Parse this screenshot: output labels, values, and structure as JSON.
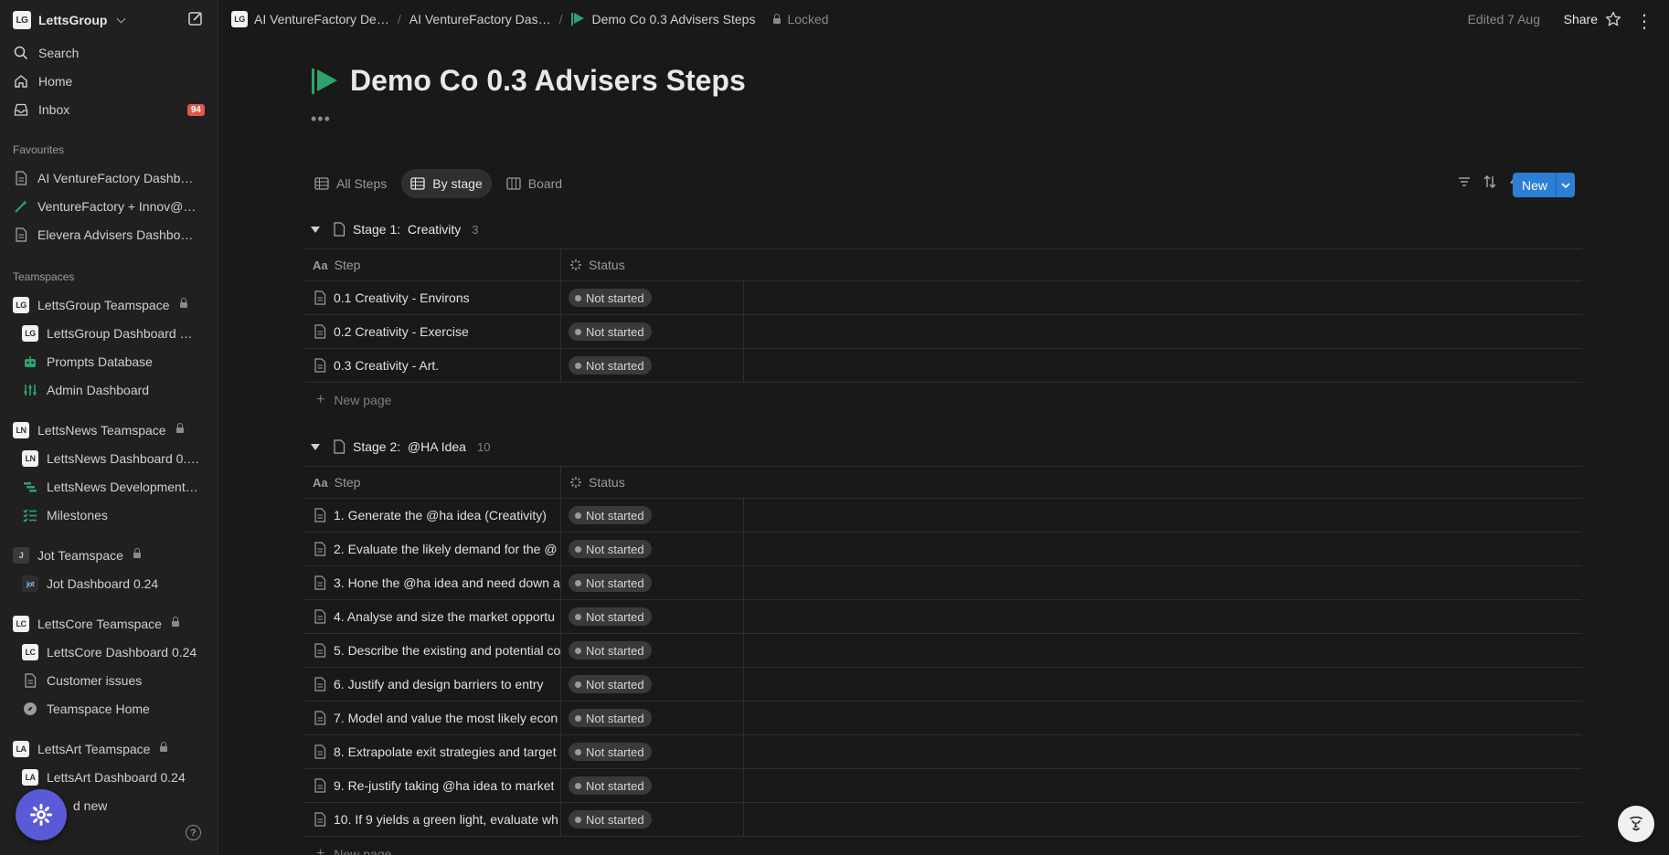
{
  "sidebar": {
    "workspace": {
      "logo": "LG",
      "name": "LettsGroup"
    },
    "nav": [
      {
        "label": "Search",
        "icon": "search-icon"
      },
      {
        "label": "Home",
        "icon": "home-icon"
      },
      {
        "label": "Inbox",
        "icon": "inbox-icon",
        "badge": "94"
      }
    ],
    "favourites_label": "Favourites",
    "favourites": [
      {
        "label": "AI VentureFactory Dashb…",
        "icon": "page-icon"
      },
      {
        "label": "VentureFactory + Innov@…",
        "icon": "magic-wand-icon"
      },
      {
        "label": "Elevera Advisers Dashbo…",
        "icon": "page-icon"
      }
    ],
    "teamspaces_label": "Teamspaces",
    "teamspaces": [
      {
        "logo": "LG",
        "name": "LettsGroup Teamspace",
        "items": [
          {
            "label": "LettsGroup Dashboard …",
            "icon": "LG"
          },
          {
            "label": "Prompts Database",
            "icon": "robot-icon"
          },
          {
            "label": "Admin Dashboard",
            "icon": "sliders-icon"
          }
        ]
      },
      {
        "logo": "LN",
        "name": "LettsNews Teamspace",
        "items": [
          {
            "label": "LettsNews Dashboard 0.…",
            "icon": "LN"
          },
          {
            "label": "LettsNews Development…",
            "icon": "gantt-icon"
          },
          {
            "label": "Milestones",
            "icon": "checklist-icon"
          }
        ]
      },
      {
        "logo": "J",
        "name": "Jot Teamspace",
        "items": [
          {
            "label": "Jot Dashboard 0.24",
            "icon": "jot"
          }
        ]
      },
      {
        "logo": "LC",
        "name": "LettsCore Teamspace",
        "items": [
          {
            "label": "LettsCore Dashboard 0.24",
            "icon": "LC"
          },
          {
            "label": "Customer issues",
            "icon": "page-icon"
          },
          {
            "label": "Teamspace Home",
            "icon": "compass-icon"
          }
        ]
      },
      {
        "logo": "LA",
        "name": "LettsArt Teamspace",
        "items": [
          {
            "label": "LettsArt Dashboard 0.24",
            "icon": "LA"
          }
        ]
      }
    ],
    "add_new_label": "d new"
  },
  "topbar": {
    "breadcrumbs": [
      {
        "label": "AI VentureFactory De…",
        "icon": "LG"
      },
      {
        "label": "AI VentureFactory Das…"
      },
      {
        "label": "Demo Co 0.3 Advisers Steps",
        "icon": "flag-icon"
      }
    ],
    "locked_label": "Locked",
    "edited": "Edited 7 Aug",
    "share": "Share"
  },
  "page": {
    "title": "Demo Co 0.3 Advisers Steps",
    "tabs": [
      {
        "label": "All Steps",
        "icon": "table-icon",
        "active": false
      },
      {
        "label": "By stage",
        "icon": "table-icon",
        "active": true
      },
      {
        "label": "Board",
        "icon": "board-icon",
        "active": false
      }
    ],
    "new_button": "New",
    "columns": {
      "step": "Step",
      "status": "Status"
    },
    "new_page_label": "New page",
    "groups": [
      {
        "title": "Stage 1:  Creativity",
        "count": "3",
        "rows": [
          {
            "step": "0.1 Creativity - Environs",
            "status": "Not started"
          },
          {
            "step": "0.2 Creativity - Exercise",
            "status": "Not started"
          },
          {
            "step": "0.3 Creativity - Art.",
            "status": "Not started"
          }
        ]
      },
      {
        "title": "Stage 2:  @HA Idea",
        "count": "10",
        "rows": [
          {
            "step": "1. Generate the @ha idea (Creativity)",
            "status": "Not started"
          },
          {
            "step": "2. Evaluate the likely demand for the @",
            "status": "Not started"
          },
          {
            "step": "3. Hone the @ha idea and need down a",
            "status": "Not started"
          },
          {
            "step": "4. Analyse and size the market opportu",
            "status": "Not started"
          },
          {
            "step": "5. Describe the existing and potential co",
            "status": "Not started"
          },
          {
            "step": "6. Justify and design barriers to entry",
            "status": "Not started"
          },
          {
            "step": "7. Model and value the most likely econ",
            "status": "Not started"
          },
          {
            "step": "8. Extrapolate exit strategies and target",
            "status": "Not started"
          },
          {
            "step": "9. Re-justify taking @ha idea to market",
            "status": "Not started"
          },
          {
            "step": "10. If 9 yields a green light, evaluate wh",
            "status": "Not started"
          }
        ]
      }
    ]
  },
  "colors": {
    "accent": "#2d7ed5",
    "badge": "#e0574b",
    "flag": "#2ea36b"
  }
}
